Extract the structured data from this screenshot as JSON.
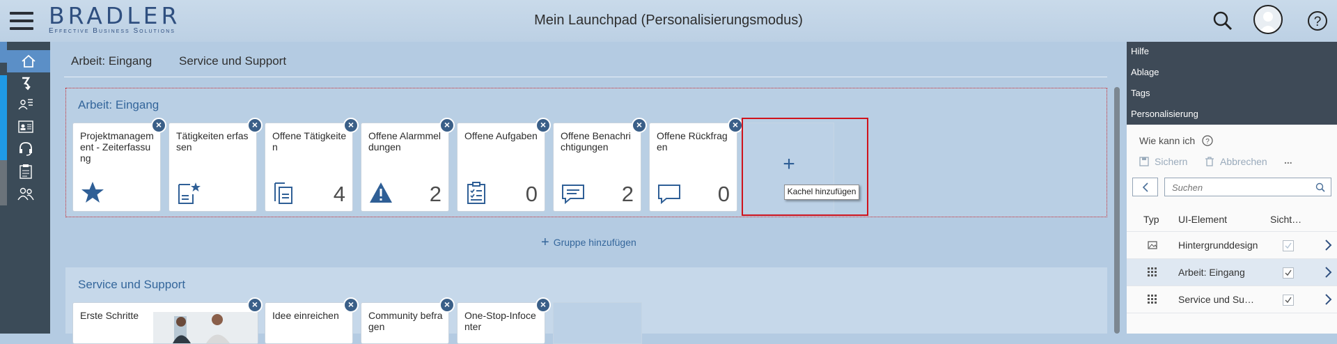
{
  "header": {
    "logo_main": "BRADLER",
    "logo_sub": "Effective Business Solutions",
    "title": "Mein Launchpad (Personalisierungsmodus)"
  },
  "tabs": [
    "Arbeit: Eingang",
    "Service und Support"
  ],
  "group1": {
    "title": "Arbeit: Eingang",
    "tiles": [
      {
        "title": "Projektmanagement - Zeiterfassung",
        "icon": "star-icon",
        "count": ""
      },
      {
        "title": "Tätigkeiten erfassen",
        "icon": "document-star-icon",
        "count": ""
      },
      {
        "title": "Offene Tätigkeiten",
        "icon": "documents-icon",
        "count": "4"
      },
      {
        "title": "Offene Alarmmeldungen",
        "icon": "warning-icon",
        "count": "2"
      },
      {
        "title": "Offene Aufgaben",
        "icon": "checklist-icon",
        "count": "0"
      },
      {
        "title": "Offene Benachrichtigungen",
        "icon": "message-icon",
        "count": "2"
      },
      {
        "title": "Offene Rückfragen",
        "icon": "speech-bubble-icon",
        "count": "0"
      }
    ],
    "add_tile_tooltip": "Kachel hinzufügen",
    "add_tile_symbol": "+"
  },
  "add_group_label": "Gruppe hinzufügen",
  "group2": {
    "title": "Service und Support",
    "tiles": [
      {
        "title": "Erste Schritte"
      },
      {
        "title": "Idee einreichen"
      },
      {
        "title": "Community befragen"
      },
      {
        "title": "One-Stop-Infocenter"
      }
    ]
  },
  "right_panel": {
    "menu": [
      "Hilfe",
      "Ablage",
      "Tags",
      "Personalisierung"
    ],
    "help_text": "Wie kann ich",
    "save_label": "Sichern",
    "cancel_label": "Abbrechen",
    "more_label": "...",
    "search_placeholder": "Suchen",
    "columns": [
      "Typ",
      "UI-Element",
      "Sicht…"
    ],
    "rows": [
      {
        "type_icon": "image-icon",
        "element": "Hintergrunddesign",
        "visible": true,
        "selected": false
      },
      {
        "type_icon": "grid-icon",
        "element": "Arbeit: Eingang",
        "visible": true,
        "selected": true
      },
      {
        "type_icon": "grid-icon",
        "element": "Service und Su…",
        "visible": true,
        "selected": false
      }
    ]
  },
  "colors": {
    "accent": "#34669b",
    "nav_active": "#5b8fc7",
    "highlight_frame": "#d0121b",
    "nav_strip": [
      "#5b8fc7",
      "#1f9ae6",
      "#1f9ae6",
      "#1f9ae6",
      "#6b737a"
    ]
  }
}
